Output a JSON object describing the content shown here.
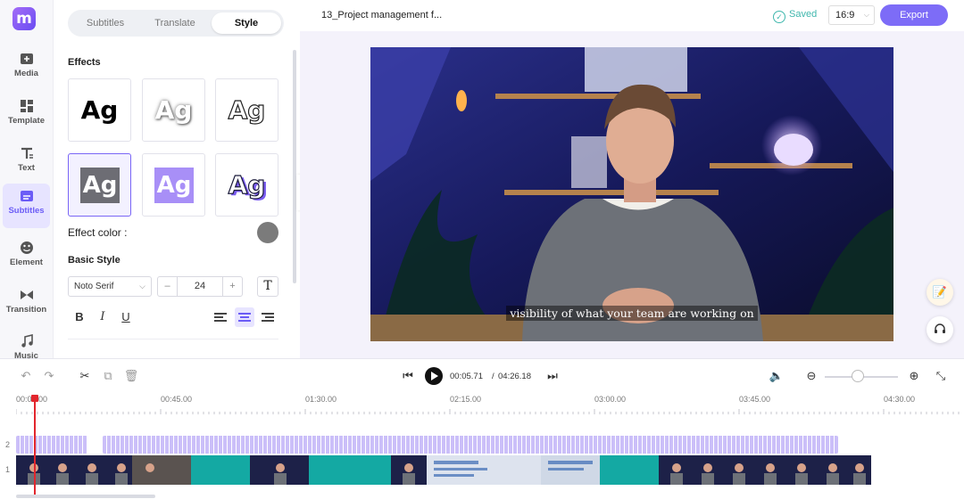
{
  "project_name": "13_Project management f...",
  "save_status": "Saved",
  "aspect_ratio": "16:9",
  "export_label": "Export",
  "rail": [
    {
      "label": "Media",
      "icon": "media-icon"
    },
    {
      "label": "Template",
      "icon": "template-icon"
    },
    {
      "label": "Text",
      "icon": "text-icon"
    },
    {
      "label": "Subtitles",
      "icon": "subtitles-icon",
      "active": true
    },
    {
      "label": "Element",
      "icon": "element-icon"
    },
    {
      "label": "Transition",
      "icon": "transition-icon"
    },
    {
      "label": "Music",
      "icon": "music-icon"
    }
  ],
  "panel": {
    "tabs": [
      "Subtitles",
      "Translate",
      "Style"
    ],
    "active_tab": "Style",
    "effects_title": "Effects",
    "effect_samples": [
      "Ag",
      "Ag",
      "Ag",
      "Ag",
      "Ag",
      "Ag"
    ],
    "selected_effect": 4,
    "effect_color_label": "Effect color :",
    "effect_color": "#7b7b7b",
    "basic_style_title": "Basic Style",
    "font": "Noto Serif",
    "font_size": "24",
    "minus": "–",
    "plus": "+",
    "text_btn": "T",
    "bold": "B",
    "italic": "I",
    "underline": "U",
    "alignment": "center"
  },
  "preview": {
    "subtitle": "visibility of what your team are working on"
  },
  "timeline": {
    "current_time": "00:05.71",
    "separator": "/",
    "total_time": "04:26.18",
    "ticks": [
      "00:00.00",
      "00:45.00",
      "01:30.00",
      "02:15.00",
      "03:00.00",
      "03:45.00",
      "04:30.00"
    ],
    "track_labels": [
      "2",
      "1"
    ],
    "zoom_level": 0.45
  },
  "colors": {
    "accent": "#7d6cf7",
    "saved": "#3fb7ad",
    "playhead": "#e2262d",
    "subtitle_blocks": "#cbbff9",
    "teal_clip": "#14a9a3"
  }
}
